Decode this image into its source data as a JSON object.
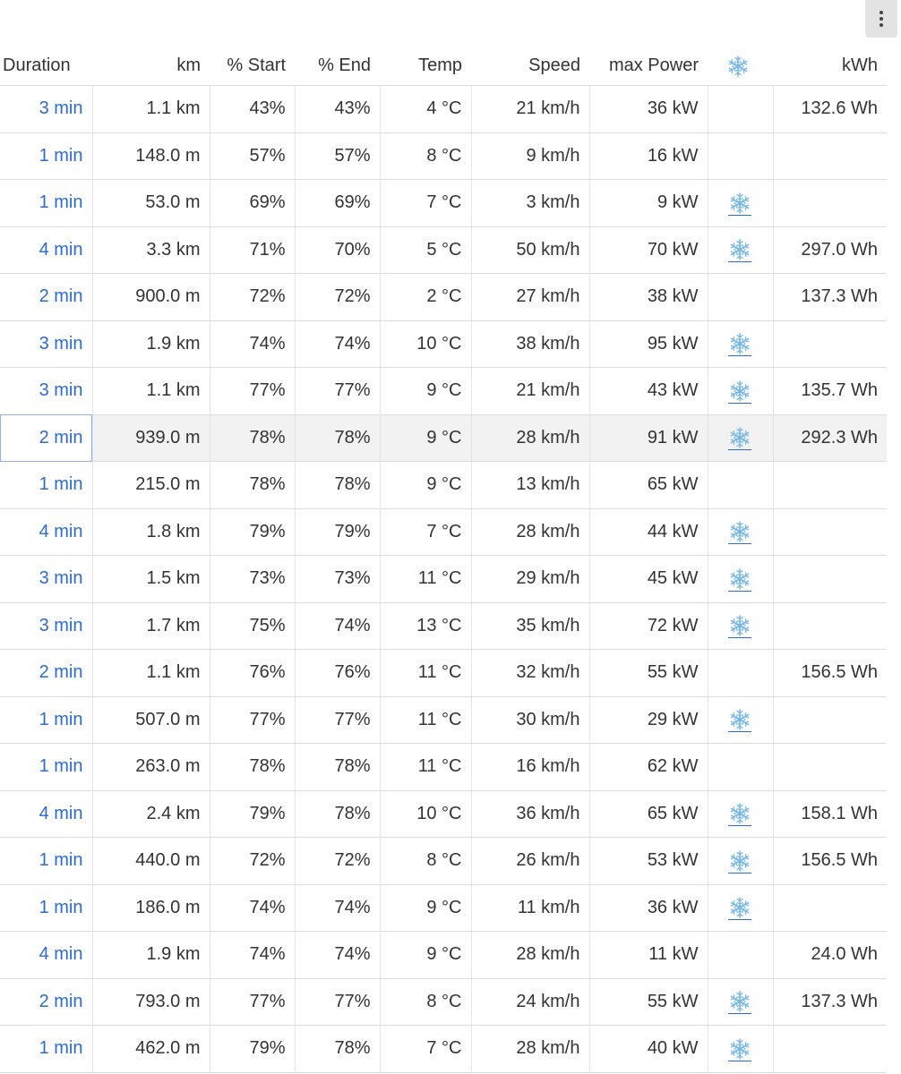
{
  "colors": {
    "link": "#2a6bd6",
    "snow": "#7ab8e8",
    "border": "#dcdcdc",
    "highlight_row": "#f2f2f2"
  },
  "toolbar": {
    "menu_icon": "kebab-vertical-icon"
  },
  "columns": {
    "duration": "Duration",
    "km": "km",
    "start": "% Start",
    "end": "% End",
    "temp": "Temp",
    "speed": "Speed",
    "max_power": "max Power",
    "ac_icon": "snowflake-icon",
    "kwh": "kWh"
  },
  "rows": [
    {
      "duration": "3 min",
      "km": "1.1 km",
      "start": "43%",
      "end": "43%",
      "temp": "4 °C",
      "speed": "21 km/h",
      "max_power": "36 kW",
      "ac": false,
      "kwh": "132.6 Wh"
    },
    {
      "duration": "1 min",
      "km": "148.0 m",
      "start": "57%",
      "end": "57%",
      "temp": "8 °C",
      "speed": "9 km/h",
      "max_power": "16 kW",
      "ac": false,
      "kwh": ""
    },
    {
      "duration": "1 min",
      "km": "53.0 m",
      "start": "69%",
      "end": "69%",
      "temp": "7 °C",
      "speed": "3 km/h",
      "max_power": "9 kW",
      "ac": true,
      "kwh": ""
    },
    {
      "duration": "4 min",
      "km": "3.3 km",
      "start": "71%",
      "end": "70%",
      "temp": "5 °C",
      "speed": "50 km/h",
      "max_power": "70 kW",
      "ac": true,
      "kwh": "297.0 Wh"
    },
    {
      "duration": "2 min",
      "km": "900.0 m",
      "start": "72%",
      "end": "72%",
      "temp": "2 °C",
      "speed": "27 km/h",
      "max_power": "38 kW",
      "ac": false,
      "kwh": "137.3 Wh"
    },
    {
      "duration": "3 min",
      "km": "1.9 km",
      "start": "74%",
      "end": "74%",
      "temp": "10 °C",
      "speed": "38 km/h",
      "max_power": "95 kW",
      "ac": true,
      "kwh": ""
    },
    {
      "duration": "3 min",
      "km": "1.1 km",
      "start": "77%",
      "end": "77%",
      "temp": "9 °C",
      "speed": "21 km/h",
      "max_power": "43 kW",
      "ac": true,
      "kwh": "135.7 Wh"
    },
    {
      "duration": "2 min",
      "km": "939.0 m",
      "start": "78%",
      "end": "78%",
      "temp": "9 °C",
      "speed": "28 km/h",
      "max_power": "91 kW",
      "ac": true,
      "kwh": "292.3 Wh",
      "highlight": true
    },
    {
      "duration": "1 min",
      "km": "215.0 m",
      "start": "78%",
      "end": "78%",
      "temp": "9 °C",
      "speed": "13 km/h",
      "max_power": "65 kW",
      "ac": false,
      "kwh": ""
    },
    {
      "duration": "4 min",
      "km": "1.8 km",
      "start": "79%",
      "end": "79%",
      "temp": "7 °C",
      "speed": "28 km/h",
      "max_power": "44 kW",
      "ac": true,
      "kwh": ""
    },
    {
      "duration": "3 min",
      "km": "1.5 km",
      "start": "73%",
      "end": "73%",
      "temp": "11 °C",
      "speed": "29 km/h",
      "max_power": "45 kW",
      "ac": true,
      "kwh": ""
    },
    {
      "duration": "3 min",
      "km": "1.7 km",
      "start": "75%",
      "end": "74%",
      "temp": "13 °C",
      "speed": "35 km/h",
      "max_power": "72 kW",
      "ac": true,
      "kwh": ""
    },
    {
      "duration": "2 min",
      "km": "1.1 km",
      "start": "76%",
      "end": "76%",
      "temp": "11 °C",
      "speed": "32 km/h",
      "max_power": "55 kW",
      "ac": false,
      "kwh": "156.5 Wh"
    },
    {
      "duration": "1 min",
      "km": "507.0 m",
      "start": "77%",
      "end": "77%",
      "temp": "11 °C",
      "speed": "30 km/h",
      "max_power": "29 kW",
      "ac": true,
      "kwh": ""
    },
    {
      "duration": "1 min",
      "km": "263.0 m",
      "start": "78%",
      "end": "78%",
      "temp": "11 °C",
      "speed": "16 km/h",
      "max_power": "62 kW",
      "ac": false,
      "kwh": ""
    },
    {
      "duration": "4 min",
      "km": "2.4 km",
      "start": "79%",
      "end": "78%",
      "temp": "10 °C",
      "speed": "36 km/h",
      "max_power": "65 kW",
      "ac": true,
      "kwh": "158.1 Wh"
    },
    {
      "duration": "1 min",
      "km": "440.0 m",
      "start": "72%",
      "end": "72%",
      "temp": "8 °C",
      "speed": "26 km/h",
      "max_power": "53 kW",
      "ac": true,
      "kwh": "156.5 Wh"
    },
    {
      "duration": "1 min",
      "km": "186.0 m",
      "start": "74%",
      "end": "74%",
      "temp": "9 °C",
      "speed": "11 km/h",
      "max_power": "36 kW",
      "ac": true,
      "kwh": ""
    },
    {
      "duration": "4 min",
      "km": "1.9 km",
      "start": "74%",
      "end": "74%",
      "temp": "9 °C",
      "speed": "28 km/h",
      "max_power": "11 kW",
      "ac": false,
      "kwh": "24.0 Wh"
    },
    {
      "duration": "2 min",
      "km": "793.0 m",
      "start": "77%",
      "end": "77%",
      "temp": "8 °C",
      "speed": "24 km/h",
      "max_power": "55 kW",
      "ac": true,
      "kwh": "137.3 Wh"
    },
    {
      "duration": "1 min",
      "km": "462.0 m",
      "start": "79%",
      "end": "78%",
      "temp": "7 °C",
      "speed": "28 km/h",
      "max_power": "40 kW",
      "ac": true,
      "kwh": ""
    }
  ]
}
